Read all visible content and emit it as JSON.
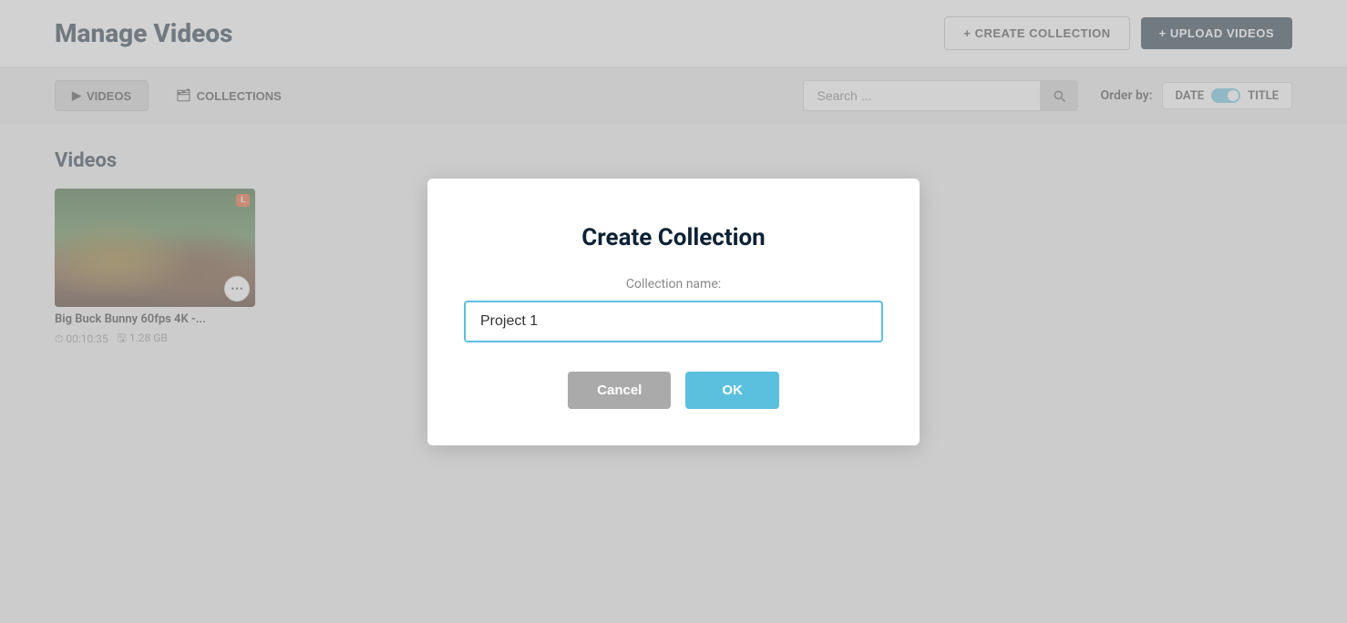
{
  "header": {
    "title": "Manage Videos",
    "btn_create_collection": "+ CREATE COLLECTION",
    "btn_upload_videos": "+ UPLOAD VIDEOS"
  },
  "toolbar": {
    "tab_videos_label": "VIDEOS",
    "tab_collections_label": "COLLECTIONS",
    "search_placeholder": "Search ...",
    "order_by_label": "Order by:",
    "order_date_label": "DATE",
    "order_title_label": "TITLE"
  },
  "main": {
    "section_title": "Videos",
    "videos": [
      {
        "title": "Big Buck Bunny 60fps 4K -...",
        "duration": "00:10:35",
        "size": "1.28 GB",
        "badge": "L"
      }
    ]
  },
  "modal": {
    "title": "Create Collection",
    "field_label": "Collection name:",
    "input_value": "Project 1",
    "btn_cancel": "Cancel",
    "btn_ok": "OK"
  }
}
